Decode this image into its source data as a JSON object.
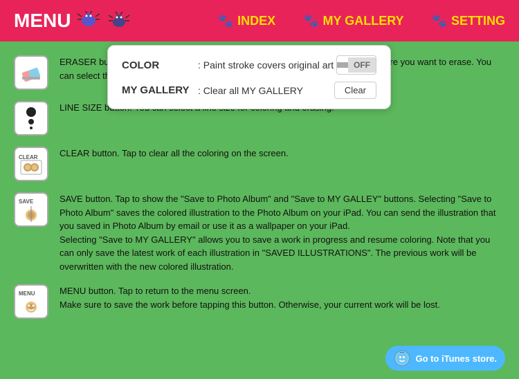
{
  "header": {
    "menu_label": "MENU",
    "nav_items": [
      {
        "id": "index",
        "label": "INDEX",
        "paw": "🐾"
      },
      {
        "id": "my-gallery",
        "label": "MY GALLERY",
        "paw": "🐾"
      },
      {
        "id": "setting",
        "label": "SETTING",
        "paw": "🐾"
      }
    ]
  },
  "popup": {
    "color_key": "COLOR",
    "color_desc": ": Paint stroke covers original art",
    "toggle_on_label": "",
    "toggle_off_label": "OFF",
    "gallery_key": "MY GALLERY",
    "gallery_desc": ": Clear all MY GALLERY",
    "clear_label": "Clear"
  },
  "instructions": [
    {
      "id": "eraser",
      "icon_label": "eraser",
      "text": "ERASER button. Tap to select the eraser. Trace the illustration with your finger where you want to erase. You can select the size of eraser from the line size button."
    },
    {
      "id": "line-size",
      "icon_label": "dots",
      "text": "LINE SIZE button. You can select a line size for coloring and erasing."
    },
    {
      "id": "clear",
      "icon_label": "CLEAR",
      "text": "CLEAR button. Tap to clear all the coloring on the screen."
    },
    {
      "id": "save",
      "icon_label": "SAVE",
      "text": "SAVE button. Tap to show the \"Save to Photo Album\" and \"Save to MY GALLEY\" buttons. Selecting \"Save to Photo Album\" saves the colored illustration to the Photo Album on your iPad. You can send the illustration that you saved in Photo Album by email or use it as a wallpaper on your iPad.\nSelecting \"Save to MY GALLERY\" allows you to save a work in progress and resume coloring. Note that you can only save the latest work of each illustration in \"SAVED ILLUSTRATIONS\". The previous work will be overwritten with the new colored illustration."
    },
    {
      "id": "menu",
      "icon_label": "MENU",
      "text": "MENU button. Tap to return to the menu screen.\nMake sure to save the work before tapping this button. Otherwise, your current work will be lost."
    }
  ],
  "itunes": {
    "label": "Go to iTunes store."
  }
}
